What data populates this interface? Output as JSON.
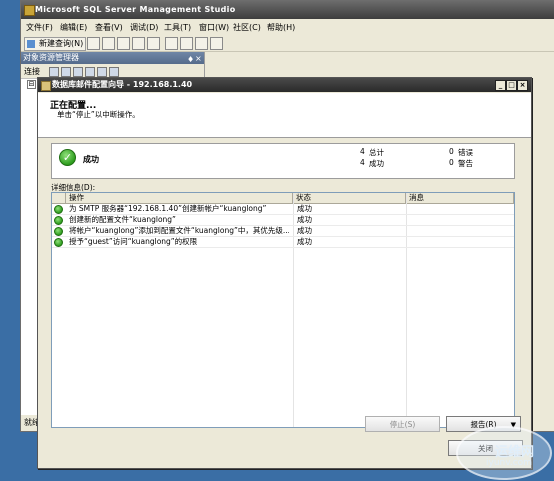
{
  "ssms": {
    "title": "Microsoft SQL Server Management Studio",
    "menu": [
      "文件(F)",
      "编辑(E)",
      "查看(V)",
      "调试(D)",
      "工具(T)",
      "窗口(W)",
      "社区(C)",
      "帮助(H)"
    ],
    "new_query": "新建查询(N)",
    "object_explorer": {
      "title": "对象资源管理器",
      "pin": "♦",
      "close": "×",
      "connect": "连接",
      "tree_expander": "⊟"
    },
    "status": "就绪"
  },
  "wizard": {
    "title": "数据库邮件配置向导 - 192.168.1.40",
    "heading": "正在配置...",
    "subheading": "单击“停止”以中断操作。",
    "summary": {
      "status": "成功",
      "total_count": "4",
      "total_label": "总计",
      "success_count": "4",
      "success_label": "成功",
      "error_count": "0",
      "error_label": "错误",
      "warning_count": "0",
      "warning_label": "警告"
    },
    "details_label": "详细信息(D):",
    "columns": [
      "操作",
      "状态",
      "消息"
    ],
    "rows": [
      {
        "action": "为 SMTP 服务器“192.168.1.40”创建新帐户“kuanglong”",
        "status": "成功",
        "message": ""
      },
      {
        "action": "创建新的配置文件“kuanglong”",
        "status": "成功",
        "message": ""
      },
      {
        "action": "将帐户“kuanglong”添加到配置文件“kuanglong”中，其优先级...",
        "status": "成功",
        "message": ""
      },
      {
        "action": "授予“guest”访问“kuanglong”的权限",
        "status": "成功",
        "message": ""
      }
    ],
    "buttons": {
      "stop": "停止(S)",
      "report": "报告(R)",
      "report_arrow": "▼",
      "close": "关闭"
    },
    "window_buttons": {
      "minimize": "_",
      "maximize": "□",
      "close": "×"
    }
  },
  "watermark": {
    "name": "运维网",
    "url": "iyunv.com"
  }
}
